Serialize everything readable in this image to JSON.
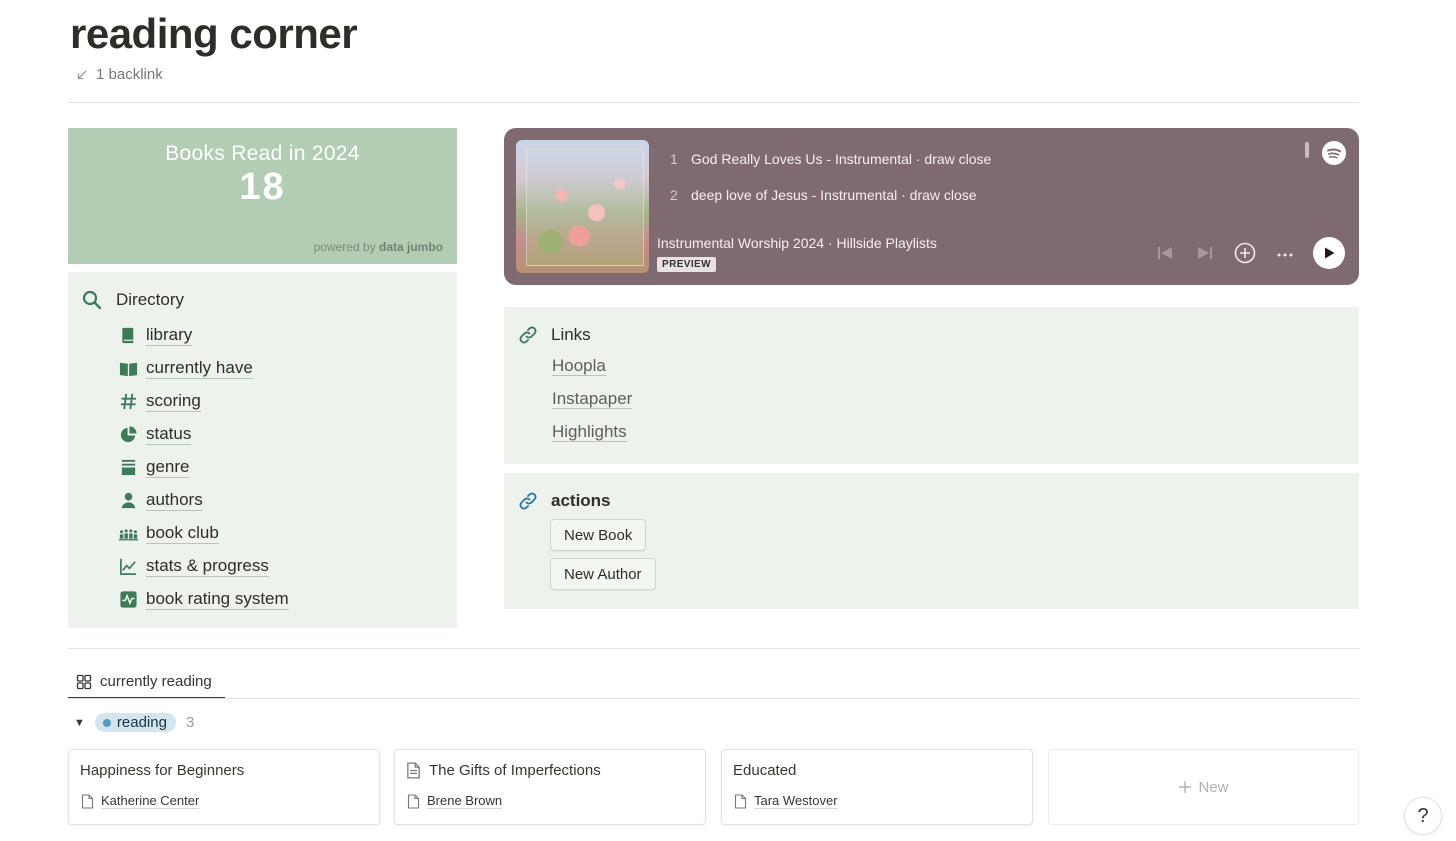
{
  "page": {
    "title": "reading corner",
    "backlinks": "1 backlink"
  },
  "counter_widget": {
    "title": "Books Read in 2024",
    "value": "18",
    "powered_by": "powered by",
    "brand": "data jumbo"
  },
  "directory": {
    "heading": "Directory",
    "items": [
      {
        "label": "library",
        "icon": "book-icon"
      },
      {
        "label": "currently have",
        "icon": "open-book-icon"
      },
      {
        "label": "scoring",
        "icon": "hash-icon"
      },
      {
        "label": "status",
        "icon": "pie-chart-icon"
      },
      {
        "label": "genre",
        "icon": "stack-icon"
      },
      {
        "label": "authors",
        "icon": "person-icon"
      },
      {
        "label": "book club",
        "icon": "group-icon"
      },
      {
        "label": "stats & progress",
        "icon": "line-chart-icon"
      },
      {
        "label": "book rating system",
        "icon": "activity-icon"
      }
    ],
    "accent_color": "#3d7a58"
  },
  "spotify": {
    "tracks": [
      {
        "number": "1",
        "title": "God Really Loves Us - Instrumental · draw close"
      },
      {
        "number": "2",
        "title": "deep love of Jesus - Instrumental · draw close"
      }
    ],
    "playlist": "Instrumental Worship 2024 · Hillside Playlists",
    "badge": "PREVIEW",
    "background_color": "#7f6a72"
  },
  "links": {
    "heading": "Links",
    "items": [
      "Hoopla",
      "Instapaper",
      "Highlights"
    ]
  },
  "actions": {
    "heading": "actions",
    "buttons": [
      "New Book",
      "New Author"
    ]
  },
  "database": {
    "tab": "currently reading",
    "group_label": "reading",
    "group_count": "3",
    "cards": [
      {
        "title": "Happiness for Beginners",
        "author": "Katherine Center",
        "title_icon": ""
      },
      {
        "title": "The Gifts of Imperfections",
        "author": "Brene Brown",
        "title_icon": "page-icon"
      },
      {
        "title": "Educated",
        "author": "Tara Westover",
        "title_icon": ""
      }
    ],
    "new_label": "New"
  },
  "help": "?"
}
